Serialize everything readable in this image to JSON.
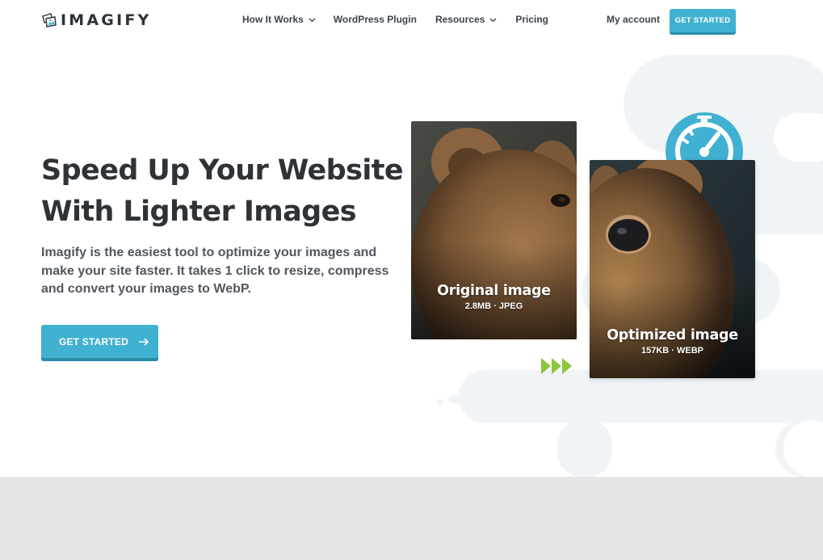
{
  "brand": {
    "name": "IMAGIFY",
    "logo_icon": "imagify-logo-icon"
  },
  "nav": {
    "items": [
      {
        "label": "How It Works",
        "has_dropdown": true
      },
      {
        "label": "WordPress Plugin",
        "has_dropdown": false
      },
      {
        "label": "Resources",
        "has_dropdown": true
      },
      {
        "label": "Pricing",
        "has_dropdown": false
      }
    ],
    "account_label": "My account",
    "cta_label": "GET STARTED"
  },
  "hero": {
    "title_lines": [
      "Speed Up Your Website",
      "With Lighter Images"
    ],
    "description_lines": [
      "Imagify is the easiest tool to optimize your images and",
      "make your site faster. It takes 1 click to resize, compress",
      "and convert your images to WebP."
    ],
    "cta_label": "GET STARTED"
  },
  "comparison": {
    "original": {
      "title": "Original image",
      "meta": "2.8MB · JPEG"
    },
    "optimized": {
      "title": "Optimized image",
      "meta": "157KB · WEBP"
    }
  },
  "colors": {
    "accent": "#40b1d0",
    "accent_shadow": "#2a8ea9",
    "arrow_green": "#8cc63f",
    "text_dark": "#2e3338",
    "blob": "#f1f4f7",
    "footer_band": "#e6e6e6"
  }
}
